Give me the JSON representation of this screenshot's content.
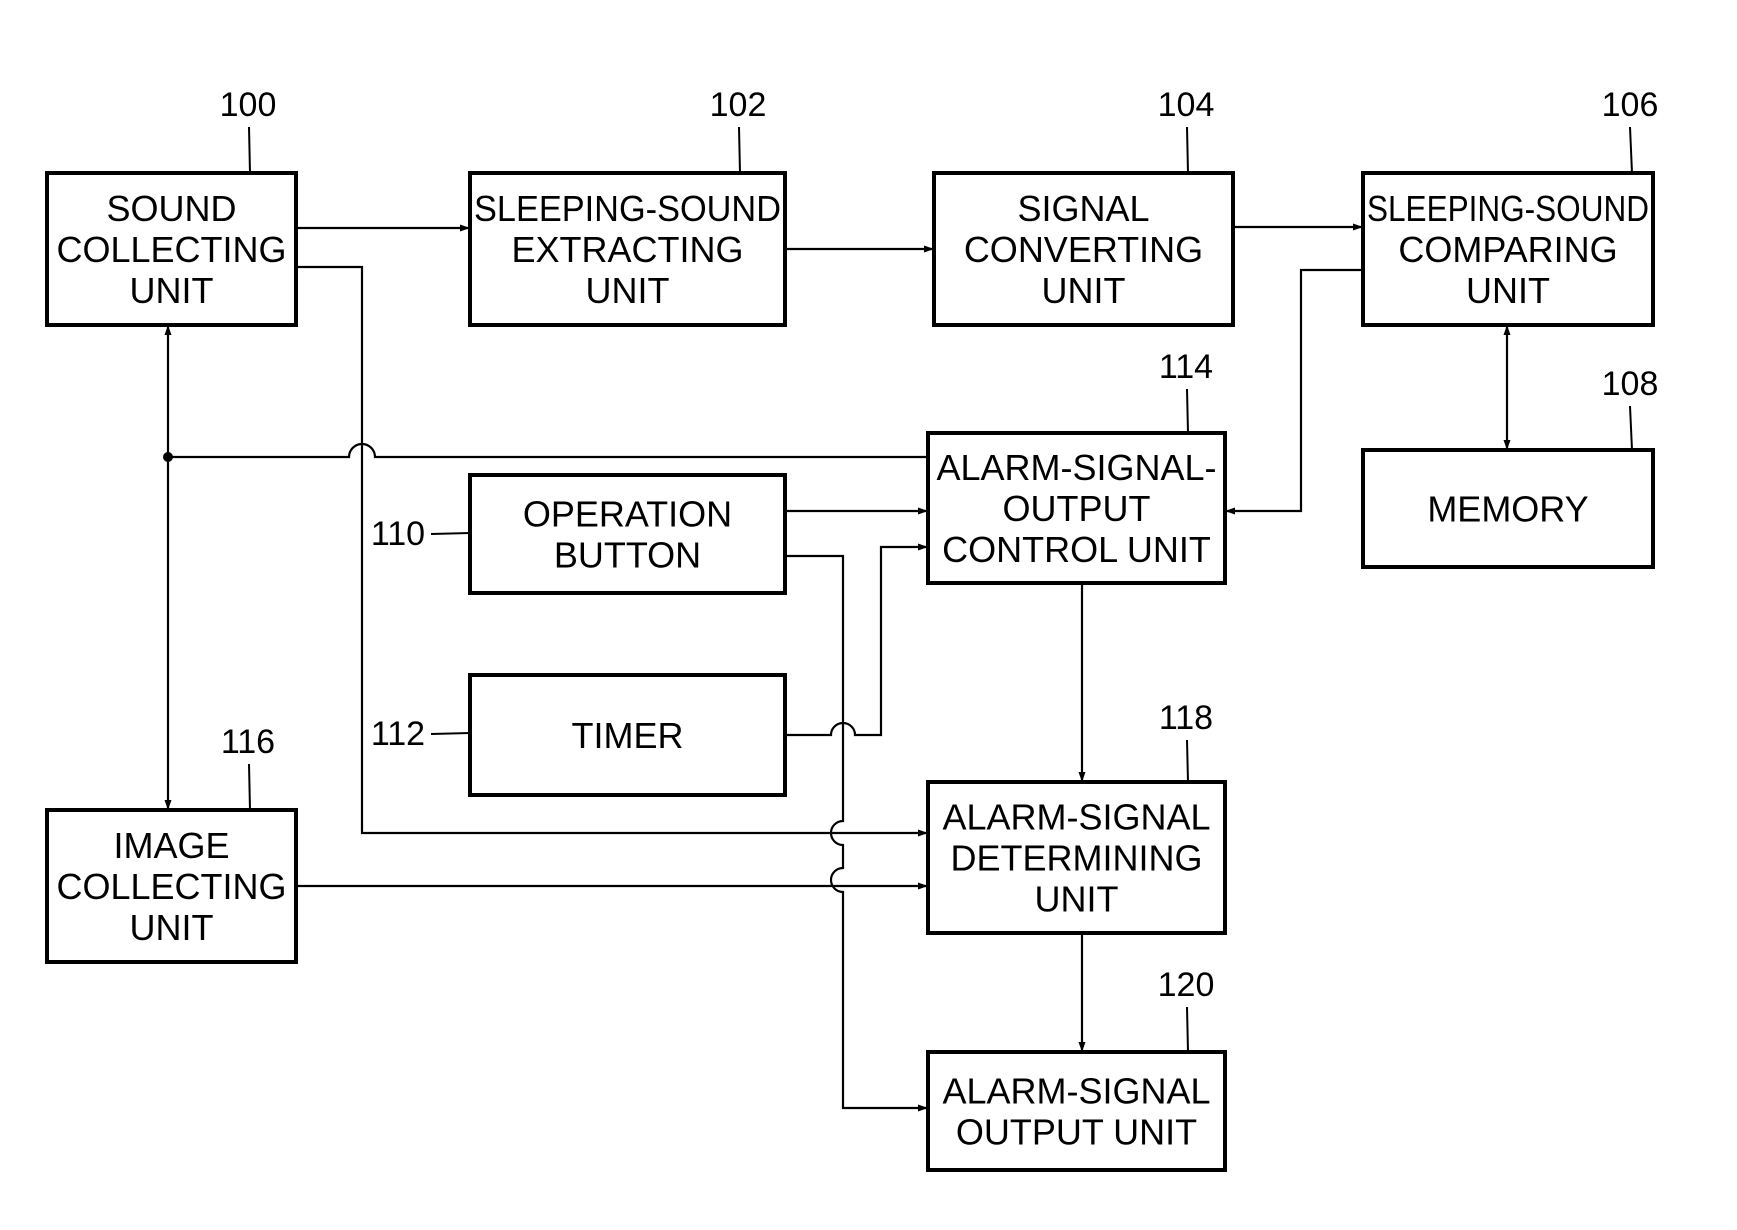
{
  "diagram": {
    "type": "block-diagram",
    "blocks": [
      {
        "id": "100",
        "ref": "100",
        "lines": [
          "SOUND",
          "COLLECTING",
          "UNIT"
        ]
      },
      {
        "id": "102",
        "ref": "102",
        "lines": [
          "SLEEPING-SOUND",
          "EXTRACTING",
          "UNIT"
        ]
      },
      {
        "id": "104",
        "ref": "104",
        "lines": [
          "SIGNAL",
          "CONVERTING",
          "UNIT"
        ]
      },
      {
        "id": "106",
        "ref": "106",
        "lines": [
          "SLEEPING-SOUND",
          "COMPARING",
          "UNIT"
        ]
      },
      {
        "id": "108",
        "ref": "108",
        "lines": [
          "MEMORY"
        ]
      },
      {
        "id": "110",
        "ref": "110",
        "lines": [
          "OPERATION",
          "BUTTON"
        ]
      },
      {
        "id": "112",
        "ref": "112",
        "lines": [
          "TIMER"
        ]
      },
      {
        "id": "114",
        "ref": "114",
        "lines": [
          "ALARM-SIGNAL-",
          "OUTPUT",
          "CONTROL UNIT"
        ]
      },
      {
        "id": "116",
        "ref": "116",
        "lines": [
          "IMAGE",
          "COLLECTING",
          "UNIT"
        ]
      },
      {
        "id": "118",
        "ref": "118",
        "lines": [
          "ALARM-SIGNAL",
          "DETERMINING",
          "UNIT"
        ]
      },
      {
        "id": "120",
        "ref": "120",
        "lines": [
          "ALARM-SIGNAL",
          "OUTPUT UNIT"
        ]
      }
    ],
    "connections": [
      {
        "from": "100",
        "to": "102"
      },
      {
        "from": "102",
        "to": "104"
      },
      {
        "from": "104",
        "to": "106"
      },
      {
        "from": "106",
        "to": "114"
      },
      {
        "from": "106",
        "to": "108",
        "bidirectional": true
      },
      {
        "from": "110",
        "to": "114"
      },
      {
        "from": "112",
        "to": "114"
      },
      {
        "from": "114",
        "to": "100"
      },
      {
        "from": "114",
        "to": "116"
      },
      {
        "from": "114",
        "to": "118"
      },
      {
        "from": "100",
        "to": "118"
      },
      {
        "from": "116",
        "to": "118"
      },
      {
        "from": "118",
        "to": "120"
      },
      {
        "from": "110",
        "to": "120"
      }
    ]
  }
}
